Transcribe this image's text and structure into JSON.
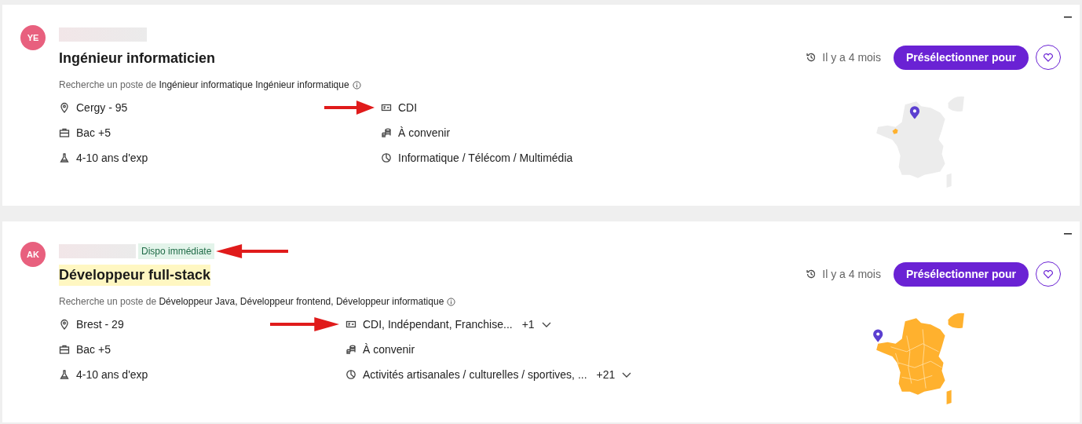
{
  "cards": [
    {
      "initials": "YE",
      "title": "Ingénieur informaticien",
      "title_highlighted": false,
      "search_prefix": "Recherche un poste de",
      "search_jobs": "Ingénieur informatique Ingénieur informatique",
      "location": "Cergy - 95",
      "education": "Bac +5",
      "experience": "4-10 ans d'exp",
      "contract": {
        "text": "CDI",
        "annotated": true
      },
      "salary": "À convenir",
      "sector": {
        "text": "Informatique / Télécom / Multimédia"
      },
      "time": "Il y a 4 mois",
      "action": "Présélectionner pour",
      "map": {
        "kind": "partial"
      }
    },
    {
      "initials": "AK",
      "badge": {
        "text": "Dispo immédiate",
        "annotated": true
      },
      "title": "Développeur full-stack",
      "title_highlighted": true,
      "search_prefix": "Recherche un poste de",
      "search_jobs": "Développeur Java, Développeur frontend, Développeur informatique",
      "location": "Brest - 29",
      "education": "Bac +5",
      "experience": "4-10 ans d'exp",
      "contract": {
        "text": "CDI, Indépendant, Franchise...",
        "more": "+1",
        "annotated": true
      },
      "salary": "À convenir",
      "sector": {
        "text": "Activités artisanales / culturelles / sportives, ...",
        "more": "+21"
      },
      "time": "Il y a 4 mois",
      "action": "Présélectionner pour",
      "map": {
        "kind": "full"
      }
    }
  ]
}
